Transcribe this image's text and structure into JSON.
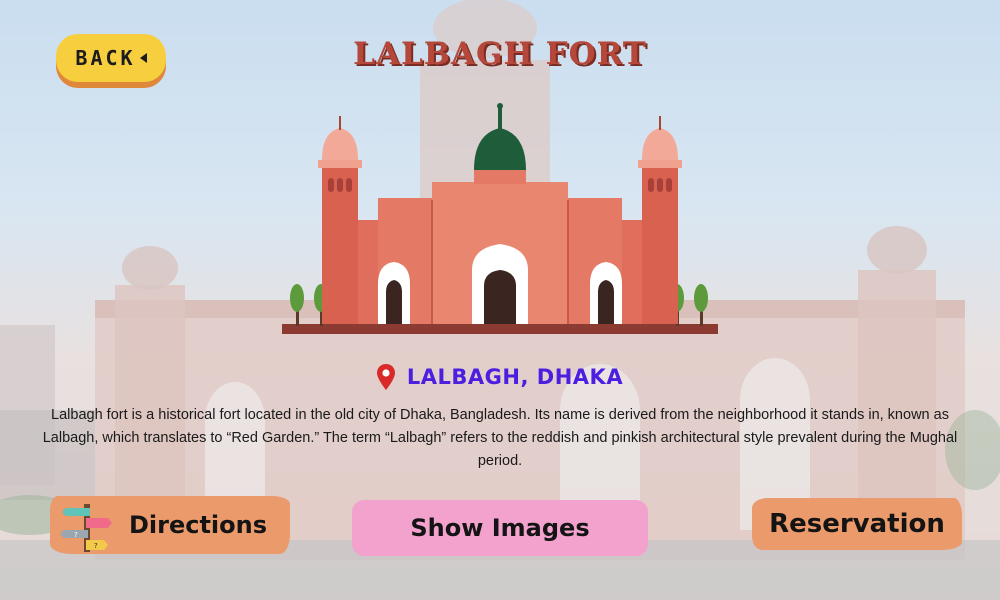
{
  "header": {
    "back_label": "BACK",
    "title": "LALBAGH FORT"
  },
  "location": {
    "icon": "map-pin-icon",
    "label": "LALBAGH, DHAKA",
    "color": "#4b1ee0"
  },
  "description": "Lalbagh fort is a historical fort located in the old city of Dhaka, Bangladesh. Its name is derived from the neighborhood it stands in, known as Lalbagh, which translates to “Red Garden.” The term “Lalbagh” refers to the reddish and pinkish architectural style prevalent during the Mughal period.",
  "actions": {
    "directions_label": "Directions",
    "directions_icon": "signpost-icon",
    "images_label": "Show Images",
    "reservation_label": "Reservation"
  },
  "colors": {
    "back_button": "#f7cf3e",
    "title": "#b5483b",
    "brush_orange": "#eb9a6b",
    "brush_pink": "#f2a2cd"
  }
}
